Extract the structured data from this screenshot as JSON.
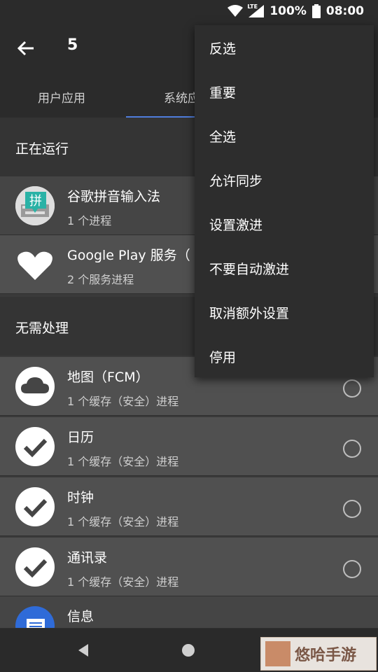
{
  "status_bar": {
    "network": "LTE",
    "battery": "100%",
    "time": "08:00"
  },
  "app_bar": {
    "title": "5"
  },
  "tabs": [
    {
      "label": "用户应用"
    },
    {
      "label": "系统应"
    }
  ],
  "sections": [
    {
      "label": "正在运行"
    },
    {
      "label": "无需处理"
    }
  ],
  "running_apps": [
    {
      "name": "谷歌拼音输入法",
      "detail": "1 个进程",
      "icon": "pinyin-keyboard-icon",
      "icon_text": "拼"
    },
    {
      "name": "Google Play 服务（",
      "detail": "2 个服务进程",
      "icon": "heart-icon"
    }
  ],
  "idle_apps": [
    {
      "name": "地图（FCM）",
      "detail": "1 个缓存（安全）进程",
      "icon": "cloud-icon"
    },
    {
      "name": "日历",
      "detail": "1 个缓存（安全）进程",
      "icon": "check-icon"
    },
    {
      "name": "时钟",
      "detail": "1 个缓存（安全）进程",
      "icon": "check-icon"
    },
    {
      "name": "通讯录",
      "detail": "1 个缓存（安全）进程",
      "icon": "check-icon"
    },
    {
      "name": "信息",
      "detail": "",
      "icon": "message-icon"
    }
  ],
  "menu": {
    "items": [
      {
        "label": "反选"
      },
      {
        "label": "重要"
      },
      {
        "label": "全选"
      },
      {
        "label": "允许同步"
      },
      {
        "label": "设置激进"
      },
      {
        "label": "不要自动激进"
      },
      {
        "label": "取消额外设置"
      },
      {
        "label": "停用"
      }
    ]
  },
  "watermark": {
    "text": "悠哈手游"
  },
  "colors": {
    "accent": "#4f7ddc",
    "menu_bg": "#2d2d2d",
    "app_bar_bg": "#2b2b2b"
  }
}
